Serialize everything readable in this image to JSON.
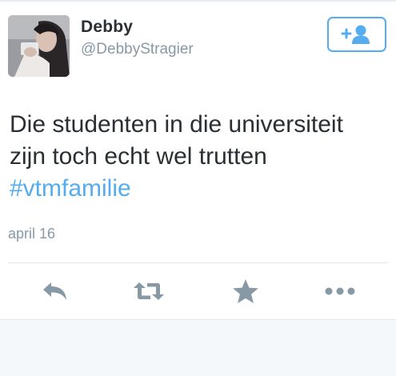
{
  "tweet": {
    "author": {
      "display_name": "Debby",
      "handle": "@DebbyStragier"
    },
    "text_line1": "Die studenten in die universiteit",
    "text_line2": "zijn toch echt wel trutten",
    "hashtag": "#vtmfamilie",
    "timestamp": "april 16"
  },
  "follow_button": {
    "icon": "add-user-icon"
  },
  "actions": [
    {
      "icon": "reply-icon"
    },
    {
      "icon": "retweet-icon"
    },
    {
      "icon": "favorite-star-icon"
    },
    {
      "icon": "more-dots-icon"
    }
  ],
  "colors": {
    "accent": "#55acee",
    "text": "#292f33",
    "secondary_text": "#8899a6",
    "action_icon": "#8899a6",
    "divider": "#e1e8ed",
    "background_below": "#f5f8fa"
  }
}
